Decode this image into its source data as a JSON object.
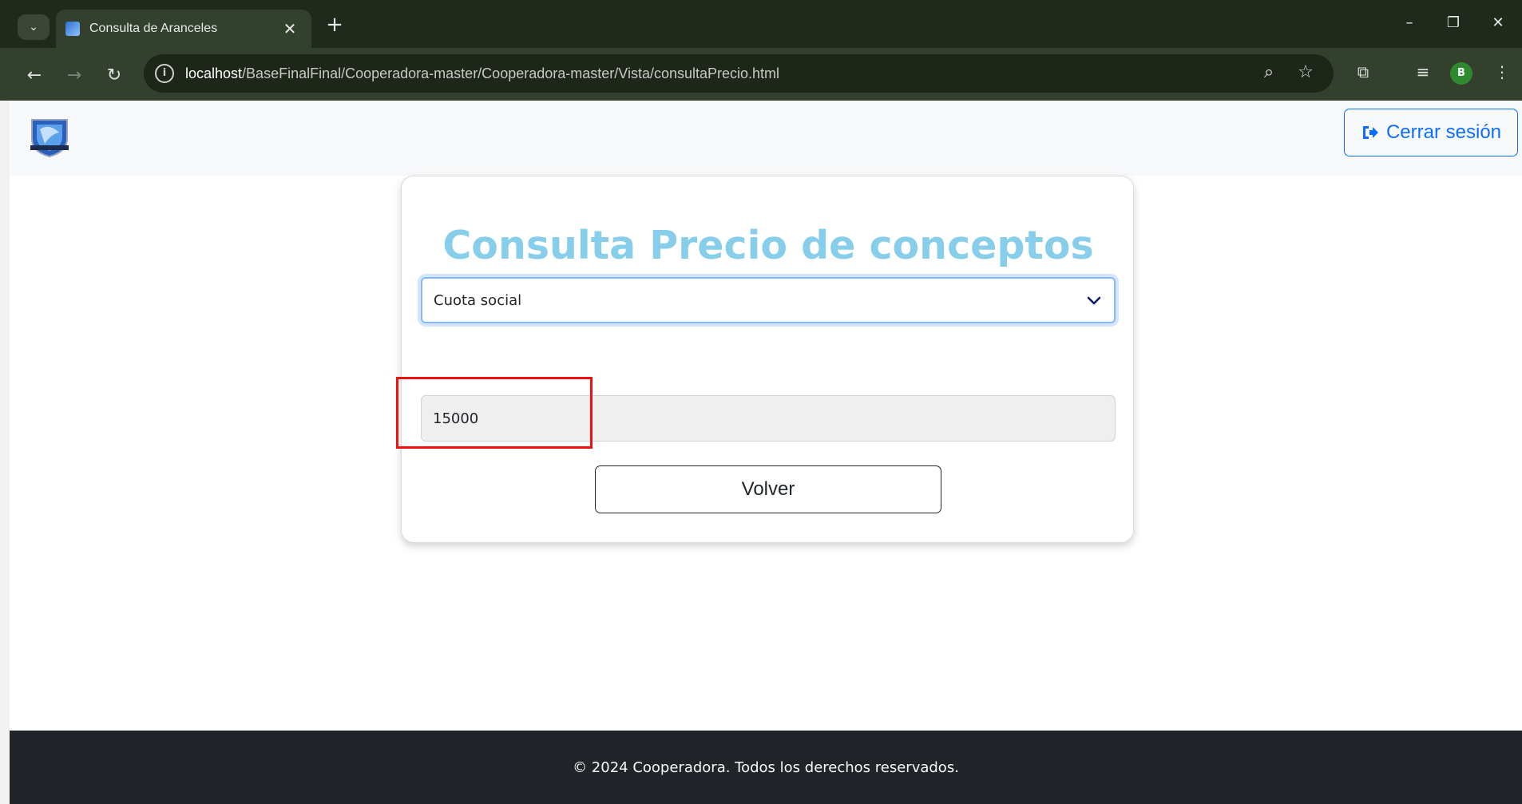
{
  "browser": {
    "tab_title": "Consulta de Aranceles",
    "tab_close": "✕",
    "new_tab": "+",
    "url_host": "localhost",
    "url_path": "/BaseFinalFinal/Cooperadora-master/Cooperadora-master/Vista/consultaPrecio.html",
    "profile_initial": "B",
    "icons": [
      "tab-list-icon",
      "favicon",
      "close-icon",
      "plus-icon",
      "minimize-icon",
      "restore-icon",
      "window-close-icon",
      "back-icon",
      "forward-icon",
      "reload-icon",
      "site-info-icon",
      "zoom-icon",
      "star-icon",
      "extensions-icon",
      "media-icon"
    ]
  },
  "navbar": {
    "logout_label": "Cerrar sesión",
    "accent_color": "#0d6efd"
  },
  "card": {
    "title": "Consulta Precio de conceptos",
    "title_color": "#87ceeb",
    "select_value": "Cuota social",
    "price_value": "15000",
    "back_label": "Volver"
  },
  "footer": {
    "text": "© 2024 Cooperadora. Todos los derechos reservados."
  },
  "annotation": {
    "highlight_color": "#ee1111"
  }
}
